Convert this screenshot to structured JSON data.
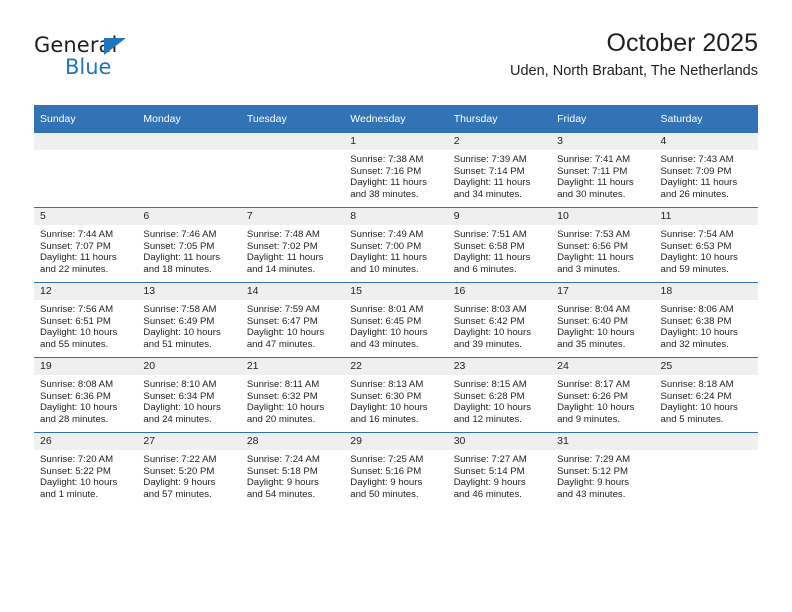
{
  "brand": {
    "name_top": "General",
    "name_bottom": "Blue",
    "color_blue": "#1f76bc"
  },
  "header": {
    "title": "October 2025",
    "subtitle": "Uden, North Brabant, The Netherlands"
  },
  "theme": {
    "header_blue": "#3273b5",
    "daynum_gray": "#efefef",
    "text": "#231f20"
  },
  "weekdays": [
    "Sunday",
    "Monday",
    "Tuesday",
    "Wednesday",
    "Thursday",
    "Friday",
    "Saturday"
  ],
  "labels": {
    "sunrise_prefix": "Sunrise: ",
    "sunset_prefix": "Sunset: ",
    "daylight_prefix": "Daylight: "
  },
  "weeks": [
    [
      {
        "day": "",
        "blank": true,
        "sunrise": "",
        "sunset": "",
        "daylight_line1": "",
        "daylight_line2": ""
      },
      {
        "day": "",
        "blank": true,
        "sunrise": "",
        "sunset": "",
        "daylight_line1": "",
        "daylight_line2": ""
      },
      {
        "day": "",
        "blank": true,
        "sunrise": "",
        "sunset": "",
        "daylight_line1": "",
        "daylight_line2": ""
      },
      {
        "day": "1",
        "blank": false,
        "sunrise": "Sunrise: 7:38 AM",
        "sunset": "Sunset: 7:16 PM",
        "daylight_line1": "Daylight: 11 hours",
        "daylight_line2": "and 38 minutes."
      },
      {
        "day": "2",
        "blank": false,
        "sunrise": "Sunrise: 7:39 AM",
        "sunset": "Sunset: 7:14 PM",
        "daylight_line1": "Daylight: 11 hours",
        "daylight_line2": "and 34 minutes."
      },
      {
        "day": "3",
        "blank": false,
        "sunrise": "Sunrise: 7:41 AM",
        "sunset": "Sunset: 7:11 PM",
        "daylight_line1": "Daylight: 11 hours",
        "daylight_line2": "and 30 minutes."
      },
      {
        "day": "4",
        "blank": false,
        "sunrise": "Sunrise: 7:43 AM",
        "sunset": "Sunset: 7:09 PM",
        "daylight_line1": "Daylight: 11 hours",
        "daylight_line2": "and 26 minutes."
      }
    ],
    [
      {
        "day": "5",
        "blank": false,
        "sunrise": "Sunrise: 7:44 AM",
        "sunset": "Sunset: 7:07 PM",
        "daylight_line1": "Daylight: 11 hours",
        "daylight_line2": "and 22 minutes."
      },
      {
        "day": "6",
        "blank": false,
        "sunrise": "Sunrise: 7:46 AM",
        "sunset": "Sunset: 7:05 PM",
        "daylight_line1": "Daylight: 11 hours",
        "daylight_line2": "and 18 minutes."
      },
      {
        "day": "7",
        "blank": false,
        "sunrise": "Sunrise: 7:48 AM",
        "sunset": "Sunset: 7:02 PM",
        "daylight_line1": "Daylight: 11 hours",
        "daylight_line2": "and 14 minutes."
      },
      {
        "day": "8",
        "blank": false,
        "sunrise": "Sunrise: 7:49 AM",
        "sunset": "Sunset: 7:00 PM",
        "daylight_line1": "Daylight: 11 hours",
        "daylight_line2": "and 10 minutes."
      },
      {
        "day": "9",
        "blank": false,
        "sunrise": "Sunrise: 7:51 AM",
        "sunset": "Sunset: 6:58 PM",
        "daylight_line1": "Daylight: 11 hours",
        "daylight_line2": "and 6 minutes."
      },
      {
        "day": "10",
        "blank": false,
        "sunrise": "Sunrise: 7:53 AM",
        "sunset": "Sunset: 6:56 PM",
        "daylight_line1": "Daylight: 11 hours",
        "daylight_line2": "and 3 minutes."
      },
      {
        "day": "11",
        "blank": false,
        "sunrise": "Sunrise: 7:54 AM",
        "sunset": "Sunset: 6:53 PM",
        "daylight_line1": "Daylight: 10 hours",
        "daylight_line2": "and 59 minutes."
      }
    ],
    [
      {
        "day": "12",
        "blank": false,
        "sunrise": "Sunrise: 7:56 AM",
        "sunset": "Sunset: 6:51 PM",
        "daylight_line1": "Daylight: 10 hours",
        "daylight_line2": "and 55 minutes."
      },
      {
        "day": "13",
        "blank": false,
        "sunrise": "Sunrise: 7:58 AM",
        "sunset": "Sunset: 6:49 PM",
        "daylight_line1": "Daylight: 10 hours",
        "daylight_line2": "and 51 minutes."
      },
      {
        "day": "14",
        "blank": false,
        "sunrise": "Sunrise: 7:59 AM",
        "sunset": "Sunset: 6:47 PM",
        "daylight_line1": "Daylight: 10 hours",
        "daylight_line2": "and 47 minutes."
      },
      {
        "day": "15",
        "blank": false,
        "sunrise": "Sunrise: 8:01 AM",
        "sunset": "Sunset: 6:45 PM",
        "daylight_line1": "Daylight: 10 hours",
        "daylight_line2": "and 43 minutes."
      },
      {
        "day": "16",
        "blank": false,
        "sunrise": "Sunrise: 8:03 AM",
        "sunset": "Sunset: 6:42 PM",
        "daylight_line1": "Daylight: 10 hours",
        "daylight_line2": "and 39 minutes."
      },
      {
        "day": "17",
        "blank": false,
        "sunrise": "Sunrise: 8:04 AM",
        "sunset": "Sunset: 6:40 PM",
        "daylight_line1": "Daylight: 10 hours",
        "daylight_line2": "and 35 minutes."
      },
      {
        "day": "18",
        "blank": false,
        "sunrise": "Sunrise: 8:06 AM",
        "sunset": "Sunset: 6:38 PM",
        "daylight_line1": "Daylight: 10 hours",
        "daylight_line2": "and 32 minutes."
      }
    ],
    [
      {
        "day": "19",
        "blank": false,
        "sunrise": "Sunrise: 8:08 AM",
        "sunset": "Sunset: 6:36 PM",
        "daylight_line1": "Daylight: 10 hours",
        "daylight_line2": "and 28 minutes."
      },
      {
        "day": "20",
        "blank": false,
        "sunrise": "Sunrise: 8:10 AM",
        "sunset": "Sunset: 6:34 PM",
        "daylight_line1": "Daylight: 10 hours",
        "daylight_line2": "and 24 minutes."
      },
      {
        "day": "21",
        "blank": false,
        "sunrise": "Sunrise: 8:11 AM",
        "sunset": "Sunset: 6:32 PM",
        "daylight_line1": "Daylight: 10 hours",
        "daylight_line2": "and 20 minutes."
      },
      {
        "day": "22",
        "blank": false,
        "sunrise": "Sunrise: 8:13 AM",
        "sunset": "Sunset: 6:30 PM",
        "daylight_line1": "Daylight: 10 hours",
        "daylight_line2": "and 16 minutes."
      },
      {
        "day": "23",
        "blank": false,
        "sunrise": "Sunrise: 8:15 AM",
        "sunset": "Sunset: 6:28 PM",
        "daylight_line1": "Daylight: 10 hours",
        "daylight_line2": "and 12 minutes."
      },
      {
        "day": "24",
        "blank": false,
        "sunrise": "Sunrise: 8:17 AM",
        "sunset": "Sunset: 6:26 PM",
        "daylight_line1": "Daylight: 10 hours",
        "daylight_line2": "and 9 minutes."
      },
      {
        "day": "25",
        "blank": false,
        "sunrise": "Sunrise: 8:18 AM",
        "sunset": "Sunset: 6:24 PM",
        "daylight_line1": "Daylight: 10 hours",
        "daylight_line2": "and 5 minutes."
      }
    ],
    [
      {
        "day": "26",
        "blank": false,
        "sunrise": "Sunrise: 7:20 AM",
        "sunset": "Sunset: 5:22 PM",
        "daylight_line1": "Daylight: 10 hours",
        "daylight_line2": "and 1 minute."
      },
      {
        "day": "27",
        "blank": false,
        "sunrise": "Sunrise: 7:22 AM",
        "sunset": "Sunset: 5:20 PM",
        "daylight_line1": "Daylight: 9 hours",
        "daylight_line2": "and 57 minutes."
      },
      {
        "day": "28",
        "blank": false,
        "sunrise": "Sunrise: 7:24 AM",
        "sunset": "Sunset: 5:18 PM",
        "daylight_line1": "Daylight: 9 hours",
        "daylight_line2": "and 54 minutes."
      },
      {
        "day": "29",
        "blank": false,
        "sunrise": "Sunrise: 7:25 AM",
        "sunset": "Sunset: 5:16 PM",
        "daylight_line1": "Daylight: 9 hours",
        "daylight_line2": "and 50 minutes."
      },
      {
        "day": "30",
        "blank": false,
        "sunrise": "Sunrise: 7:27 AM",
        "sunset": "Sunset: 5:14 PM",
        "daylight_line1": "Daylight: 9 hours",
        "daylight_line2": "and 46 minutes."
      },
      {
        "day": "31",
        "blank": false,
        "sunrise": "Sunrise: 7:29 AM",
        "sunset": "Sunset: 5:12 PM",
        "daylight_line1": "Daylight: 9 hours",
        "daylight_line2": "and 43 minutes."
      },
      {
        "day": "",
        "blank": true,
        "sunrise": "",
        "sunset": "",
        "daylight_line1": "",
        "daylight_line2": ""
      }
    ]
  ]
}
